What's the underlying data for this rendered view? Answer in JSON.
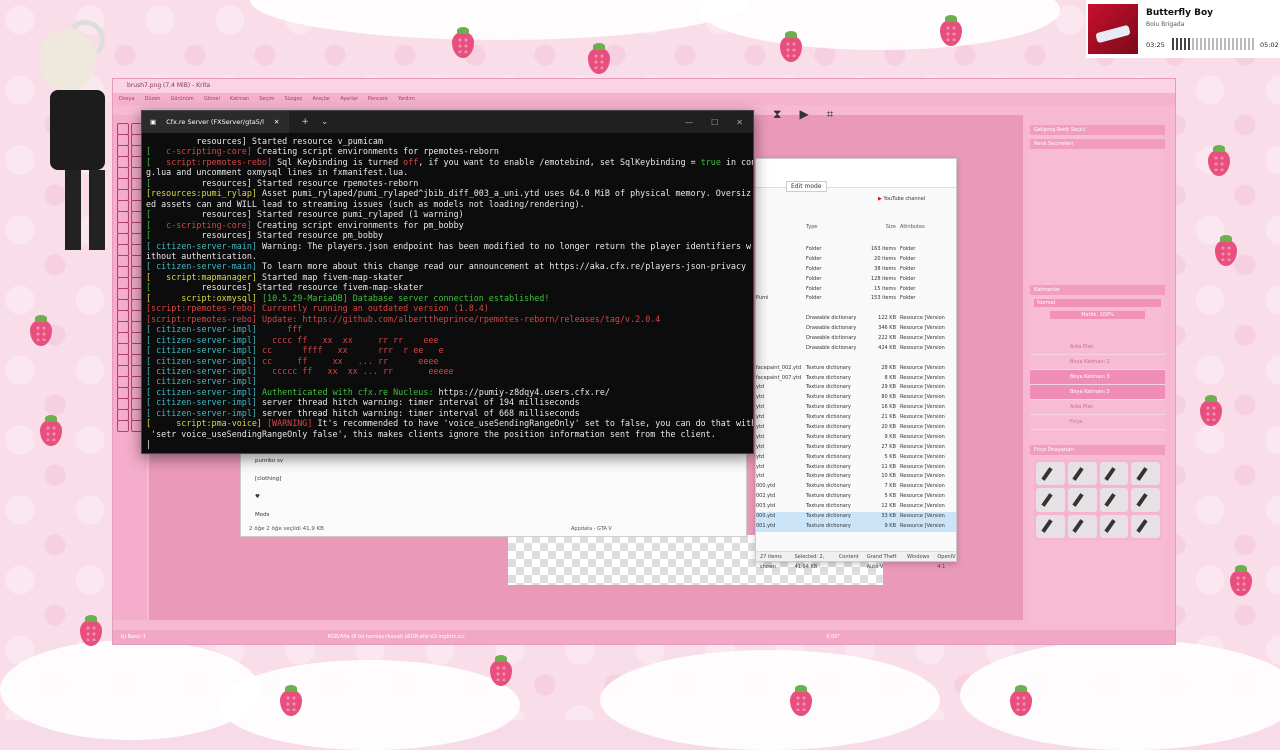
{
  "music": {
    "title": "Butterfly Boy",
    "artist": "Bolu Brigada",
    "elapsed": "03:25",
    "duration": "05:02",
    "progress": 0.68
  },
  "krita": {
    "title": "brush7.png (7,4 MiB) - Krita",
    "menu": [
      "Dosya",
      "Düzen",
      "Görünüm",
      "Görsel",
      "Katman",
      "Seçim",
      "Süzgeç",
      "Araçlar",
      "Ayarlar",
      "Pencere",
      "Yardım"
    ],
    "dock_title": "Renk Seçmeleri",
    "dock_tab": "Gelişmiş Renk Seçici",
    "layers_title": "Katmanlar",
    "blend_mode": "Normal",
    "opacity": "Matlık: 100%",
    "layers": [
      "Arka Plan",
      "Boya Katmanı 2",
      "Boya Katmanı 3",
      "Boya Katmanı 3",
      "Arka Plan",
      "Fırça"
    ],
    "brushes_title": "Fırça Önayarları",
    "status_left": "b) Basic-1",
    "status_mid": "RGB/Alfa (8 bit tamsayı/kanal) sRGB-elle-V2-srgbtrc.icc",
    "status_zoom": "0,00°"
  },
  "terminal": {
    "tab_title": "Cfx.re Server (FXServer/gta5/l",
    "lines": [
      [
        [
          "w",
          "          "
        ],
        [
          "w",
          "resources] "
        ],
        [
          "w",
          "Started resource v_pumicam"
        ]
      ],
      [
        [
          "g",
          "[   "
        ],
        [
          "r",
          "c-scripting-core] "
        ],
        [
          "w",
          "Creating script environments for rpemotes-reborn"
        ]
      ],
      [
        [
          "g",
          "[   "
        ],
        [
          "r",
          "script:rpemotes-rebo] "
        ],
        [
          "w",
          "Sql Keybinding is turned "
        ],
        [
          "r",
          "off"
        ],
        [
          "w",
          ", if you want to enable /emotebind, set SqlKeybinding = "
        ],
        [
          "g",
          "true"
        ],
        [
          "w",
          " in confi"
        ]
      ],
      [
        [
          "w",
          "g.lua and uncomment oxmysql lines in fxmanifest.lua."
        ]
      ],
      [
        [
          "g",
          "[          "
        ],
        [
          "w",
          "resources] "
        ],
        [
          "w",
          "Started resource rpemotes-reborn"
        ]
      ],
      [
        [
          "y",
          "[resources:pumi_rylap] "
        ],
        [
          "w",
          "Asset pumi_rylaped/pumi_rylaped^jbib_diff_003_a_uni.ytd uses 64.0 MiB of physical memory. Oversiz"
        ]
      ],
      [
        [
          "w",
          "ed assets can and WILL lead to streaming issues (such as models not loading/rendering)."
        ]
      ],
      [
        [
          "g",
          "[          "
        ],
        [
          "w",
          "resources] "
        ],
        [
          "w",
          "Started resource pumi_rylaped (1 warning)"
        ]
      ],
      [
        [
          "g",
          "[   "
        ],
        [
          "r",
          "c-scripting-core] "
        ],
        [
          "w",
          "Creating script environments for pm_bobby"
        ]
      ],
      [
        [
          "g",
          "[          "
        ],
        [
          "w",
          "resources] "
        ],
        [
          "w",
          "Started resource pm_bobby"
        ]
      ],
      [
        [
          "c",
          "[ citizen-server-main] "
        ],
        [
          "w",
          "Warning: The players.json endpoint has been modified to no longer return the player identifiers w"
        ]
      ],
      [
        [
          "w",
          "ithout authentication."
        ]
      ],
      [
        [
          "c",
          "[ citizen-server-main] "
        ],
        [
          "w",
          "To learn more about this change read our announcement at https://aka.cfx.re/players-json-privacy"
        ]
      ],
      [
        [
          "y",
          "[   script:mapmanager] "
        ],
        [
          "w",
          "Started map fivem-map-skater"
        ]
      ],
      [
        [
          "g",
          "[          "
        ],
        [
          "w",
          "resources] "
        ],
        [
          "w",
          "Started resource fivem-map-skater"
        ]
      ],
      [
        [
          "y",
          "[      script:oxmysql] "
        ],
        [
          "g",
          "[10.5.29-MariaDB] "
        ],
        [
          "g",
          "Database server connection established!"
        ]
      ],
      [
        [
          "r",
          "[script:rpemotes-rebo] "
        ],
        [
          "r",
          "Currently running an outdated version (1.8.4)"
        ]
      ],
      [
        [
          "r",
          "[script:rpemotes-rebo] "
        ],
        [
          "r",
          "Update: https://github.com/alberttheprince/rpemotes-reborn/releases/tag/v.2.0.4"
        ]
      ],
      [
        [
          "c",
          "[ citizen-server-impl] "
        ],
        [
          "r",
          "     fff"
        ]
      ],
      [
        [
          "c",
          "[ citizen-server-impl] "
        ],
        [
          "r",
          "  cccc ff   xx  xx     rr rr    eee"
        ]
      ],
      [
        [
          "c",
          "[ citizen-server-impl] "
        ],
        [
          "r",
          "cc      ffff   xx      rrr  r ee   e"
        ]
      ],
      [
        [
          "c",
          "[ citizen-server-impl] "
        ],
        [
          "r",
          "cc     ff     xx   ... rr      eeee"
        ]
      ],
      [
        [
          "c",
          "[ citizen-server-impl] "
        ],
        [
          "r",
          "  ccccc ff   xx  xx ... rr       eeeee"
        ]
      ],
      [
        [
          "c",
          "[ citizen-server-impl] "
        ]
      ],
      [
        [
          "c",
          "[ citizen-server-impl] "
        ],
        [
          "g",
          "Authenticated with cfx.re Nucleus: "
        ],
        [
          "w",
          "https://pumiy-z8dqy4.users.cfx.re/"
        ]
      ],
      [
        [
          "c",
          "[ citizen-server-impl] "
        ],
        [
          "w",
          "server thread hitch warning: timer interval of 194 milliseconds"
        ]
      ],
      [
        [
          "c",
          "[ citizen-server-impl] "
        ],
        [
          "w",
          "server thread hitch warning: timer interval of 668 milliseconds"
        ]
      ],
      [
        [
          "y",
          "[     script:pma-voice] "
        ],
        [
          "r",
          "[WARNING] "
        ],
        [
          "w",
          "It's recommended to have 'voice_useSendingRangeOnly' set to false, you can do that with"
        ]
      ],
      [
        [
          "w",
          " 'setr voice_useSendingRangeOnly false', this makes clients ignore the position information sent from the client."
        ]
      ],
      [
        [
          "w",
          "|"
        ]
      ]
    ]
  },
  "explorer": {
    "edit_mode": "Edit mode",
    "yt_channel": "YouTube channel",
    "headers": {
      "type": "Type",
      "size": "Size",
      "attr": "Attributes"
    },
    "rows": [
      {
        "name": "",
        "type": "Folder",
        "size": "163 items",
        "attr": "Folder",
        "sel": false
      },
      {
        "name": "",
        "type": "Folder",
        "size": "20 items",
        "attr": "Folder",
        "sel": false
      },
      {
        "name": "",
        "type": "Folder",
        "size": "38 items",
        "attr": "Folder",
        "sel": false
      },
      {
        "name": "",
        "type": "Folder",
        "size": "128 items",
        "attr": "Folder",
        "sel": false
      },
      {
        "name": "",
        "type": "Folder",
        "size": "15 items",
        "attr": "Folder",
        "sel": false
      },
      {
        "name": "Pumi",
        "type": "Folder",
        "size": "153 items",
        "attr": "Folder",
        "sel": false
      },
      {
        "name": "",
        "type": "",
        "size": "",
        "attr": "",
        "sel": false
      },
      {
        "name": "",
        "type": "Drawable dictionary",
        "size": "122 KB",
        "attr": "Resource [Version",
        "sel": false
      },
      {
        "name": "",
        "type": "Drawable dictionary",
        "size": "346 KB",
        "attr": "Resource [Version",
        "sel": false
      },
      {
        "name": "",
        "type": "Drawable dictionary",
        "size": "222 KB",
        "attr": "Resource [Version",
        "sel": false
      },
      {
        "name": "",
        "type": "Drawable dictionary",
        "size": "424 KB",
        "attr": "Resource [Version",
        "sel": false
      },
      {
        "name": "",
        "type": "",
        "size": "",
        "attr": "",
        "sel": false
      },
      {
        "name": "facepaint_002.ytd",
        "type": "Texture dictionary",
        "size": "28 KB",
        "attr": "Resource [Version",
        "sel": false
      },
      {
        "name": "facepaint_007.ytd",
        "type": "Texture dictionary",
        "size": "8 KB",
        "attr": "Resource [Version",
        "sel": false
      },
      {
        "name": "ytd",
        "type": "Texture dictionary",
        "size": "29 KB",
        "attr": "Resource [Version",
        "sel": false
      },
      {
        "name": "ytd",
        "type": "Texture dictionary",
        "size": "80 KB",
        "attr": "Resource [Version",
        "sel": false
      },
      {
        "name": "ytd",
        "type": "Texture dictionary",
        "size": "16 KB",
        "attr": "Resource [Version",
        "sel": false
      },
      {
        "name": "ytd",
        "type": "Texture dictionary",
        "size": "21 KB",
        "attr": "Resource [Version",
        "sel": false
      },
      {
        "name": "ytd",
        "type": "Texture dictionary",
        "size": "20 KB",
        "attr": "Resource [Version",
        "sel": false
      },
      {
        "name": "ytd",
        "type": "Texture dictionary",
        "size": "9 KB",
        "attr": "Resource [Version",
        "sel": false
      },
      {
        "name": "ytd",
        "type": "Texture dictionary",
        "size": "27 KB",
        "attr": "Resource [Version",
        "sel": false
      },
      {
        "name": "ytd",
        "type": "Texture dictionary",
        "size": "5 KB",
        "attr": "Resource [Version",
        "sel": false
      },
      {
        "name": "ytd",
        "type": "Texture dictionary",
        "size": "11 KB",
        "attr": "Resource [Version",
        "sel": false
      },
      {
        "name": "ytd",
        "type": "Texture dictionary",
        "size": "10 KB",
        "attr": "Resource [Version",
        "sel": false
      },
      {
        "name": "000.ytd",
        "type": "Texture dictionary",
        "size": "7 KB",
        "attr": "Resource [Version",
        "sel": false
      },
      {
        "name": "002.ytd",
        "type": "Texture dictionary",
        "size": "5 KB",
        "attr": "Resource [Version",
        "sel": false
      },
      {
        "name": "003.ytd",
        "type": "Texture dictionary",
        "size": "12 KB",
        "attr": "Resource [Version",
        "sel": false
      },
      {
        "name": "000.ytd",
        "type": "Texture dictionary",
        "size": "33 KB",
        "attr": "Resource [Version",
        "sel": true
      },
      {
        "name": "001.ytd",
        "type": "Texture dictionary",
        "size": "9 KB",
        "attr": "Resource [Version",
        "sel": true
      }
    ],
    "status": [
      "27 items shown",
      "Selected: 2,  41,94 KB",
      "Content",
      "Grand Theft Auto V",
      "Windows",
      "OpenIV 4.1"
    ]
  },
  "explorer2": {
    "sidebar": [
      "pumiko sv",
      "[clothing]",
      "♥",
      "Mods"
    ],
    "status": "2 öğe    2 öğe seçildi  41,9 KB",
    "path": "Appdata - GTA V"
  }
}
